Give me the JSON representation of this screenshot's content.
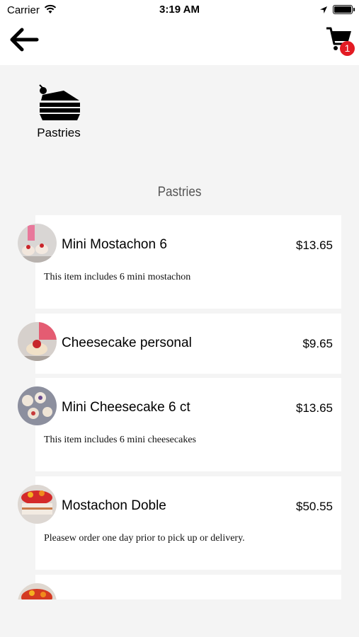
{
  "status_bar": {
    "carrier": "Carrier",
    "time": "3:19 AM"
  },
  "header": {
    "cart_count": "1"
  },
  "category": {
    "label": "Pastries"
  },
  "section": {
    "title": "Pastries"
  },
  "items": [
    {
      "name": "Mini Mostachon 6",
      "price": "$13.65",
      "description": "This item includes 6 mini mostachon"
    },
    {
      "name": "Cheesecake personal",
      "price": "$9.65",
      "description": ""
    },
    {
      "name": "Mini Cheesecake 6 ct",
      "price": "$13.65",
      "description": "This item includes 6 mini cheesecakes"
    },
    {
      "name": "Mostachon Doble",
      "price": "$50.55",
      "description": "Pleasew order one day prior to pick up or delivery."
    }
  ],
  "colors": {
    "badge": "#e31b23",
    "background": "#f4f4f4"
  }
}
